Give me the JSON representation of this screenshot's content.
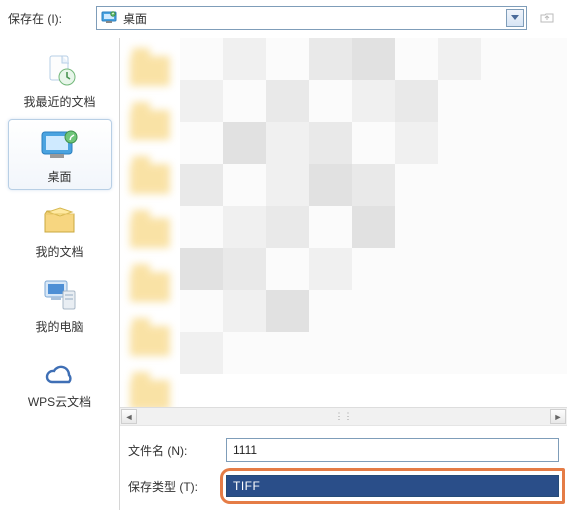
{
  "top": {
    "save_in_label": "保存在 (I):",
    "location_text": "桌面"
  },
  "sidebar": {
    "items": [
      {
        "label": "我最近的文档",
        "icon": "recent-docs-icon"
      },
      {
        "label": "桌面",
        "icon": "desktop-icon"
      },
      {
        "label": "我的文档",
        "icon": "my-documents-icon"
      },
      {
        "label": "我的电脑",
        "icon": "my-computer-icon"
      },
      {
        "label": "WPS云文档",
        "icon": "wps-cloud-icon"
      }
    ]
  },
  "bottom": {
    "filename_label": "文件名 (N):",
    "filename_value": "1111",
    "filetype_label": "保存类型 (T):",
    "filetype_value": "TIFF"
  }
}
